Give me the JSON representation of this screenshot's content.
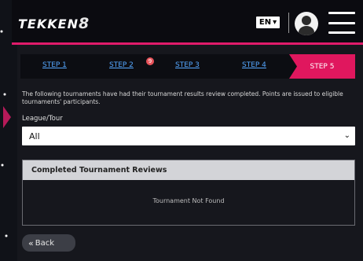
{
  "header": {
    "logo_text": "TEKKEN",
    "logo_number": "8",
    "language": "EN",
    "language_chevron": "▾"
  },
  "steps": [
    {
      "label": "STEP 1"
    },
    {
      "label": "STEP 2",
      "badge": "9"
    },
    {
      "label": "STEP 3"
    },
    {
      "label": "STEP 4"
    },
    {
      "label": "STEP 5"
    }
  ],
  "content": {
    "description": "The following tournaments have had their tournament results review completed. Points are issued to eligible tournaments' participants.",
    "league_label": "League/Tour",
    "league_value": "All",
    "reviews_header": "Completed Tournament Reviews",
    "empty_text": "Tournament Not Found",
    "back_label": "Back",
    "back_arrow": "«"
  },
  "colors": {
    "accent": "#e0175e",
    "link": "#55a7ff",
    "background": "#16171d"
  }
}
